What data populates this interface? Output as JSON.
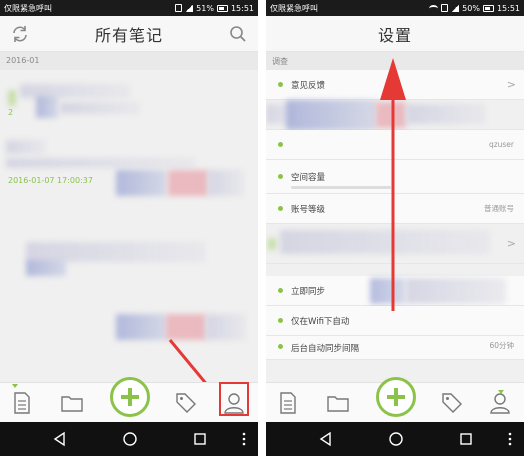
{
  "left": {
    "status": {
      "left_text": "仅限紧急呼叫",
      "battery": "51%",
      "time": "15:51"
    },
    "title": "所有笔记",
    "section_header": "2016-01",
    "notes": [
      {
        "date": "2"
      },
      {
        "date": "2016-01-07 17:00:37"
      }
    ]
  },
  "right": {
    "status": {
      "left_text": "仅限紧急呼叫",
      "battery": "50%",
      "time": "15:51"
    },
    "title": "设置",
    "section_header": "调查",
    "rows": [
      {
        "label": "意见反馈",
        "value": ">"
      },
      {
        "label": "",
        "value": ""
      },
      {
        "label": "",
        "value": "qzuser"
      },
      {
        "label": "空间容量",
        "value": ""
      },
      {
        "label": "账号等级",
        "value": "普通账号"
      },
      {
        "label": "",
        "value": ">"
      },
      {
        "label": "立即同步",
        "value": ""
      },
      {
        "label": "仅在Wifi下自动",
        "value": ""
      },
      {
        "label": "后台自动同步间隔",
        "value": "60分钟"
      }
    ]
  },
  "colors": {
    "accent": "#8bc34a",
    "annotation": "#e53935"
  },
  "icons": {
    "tabs": [
      "notes-icon",
      "folder-icon",
      "add-icon",
      "tag-icon",
      "user-icon"
    ],
    "nav": [
      "back-icon",
      "home-icon",
      "recents-icon",
      "menu-dots-icon"
    ]
  }
}
